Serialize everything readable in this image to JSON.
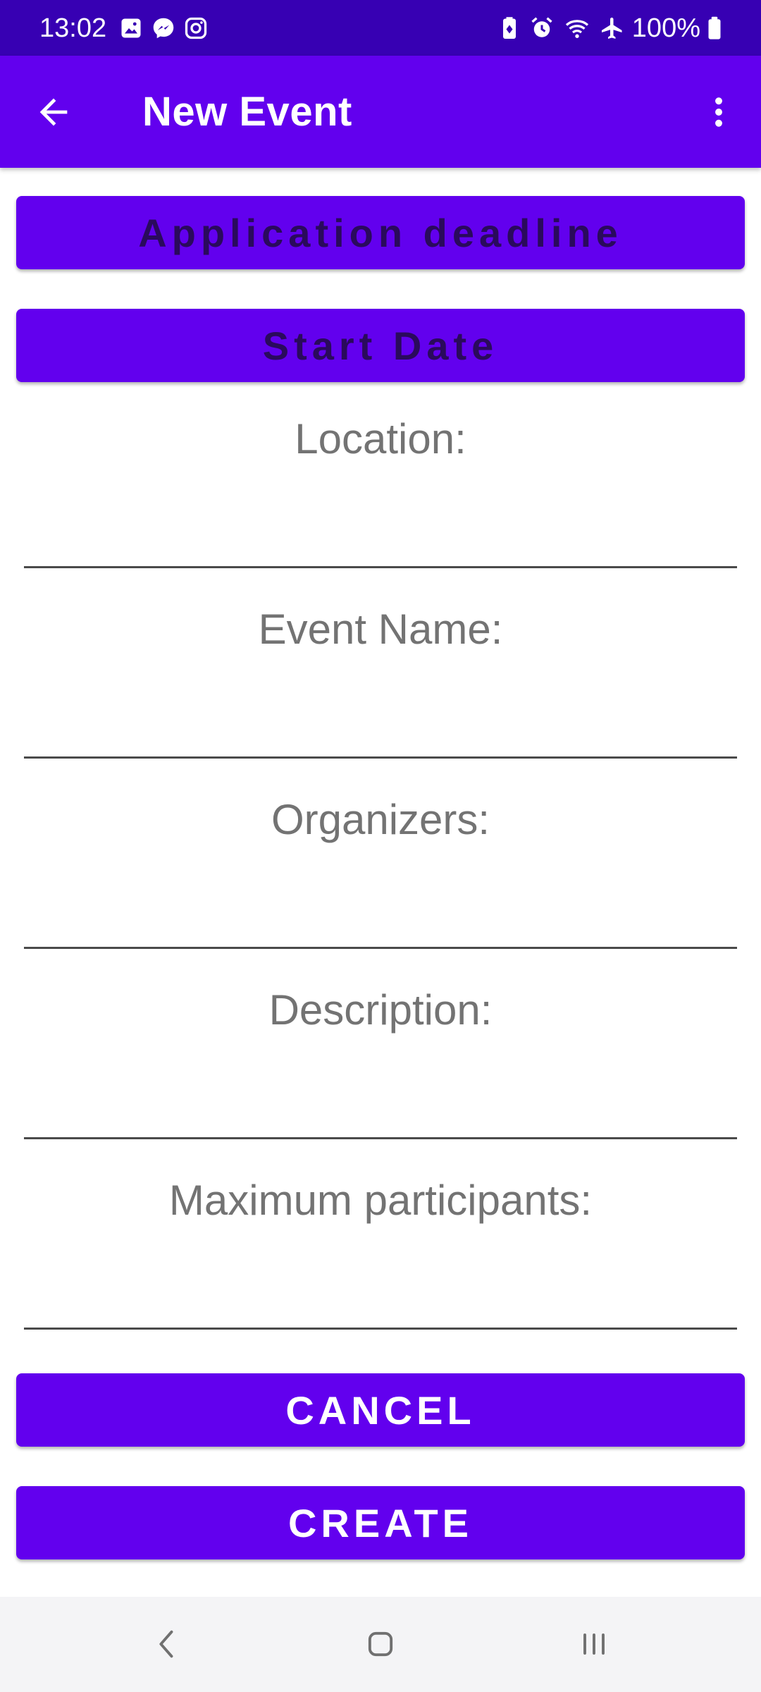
{
  "status_bar": {
    "time": "13:02",
    "left_icons": [
      "gallery-icon",
      "messenger-icon",
      "instagram-icon"
    ],
    "right_icons": [
      "battery-saver-icon",
      "alarm-icon",
      "wifi-icon",
      "airplane-icon"
    ],
    "battery_text": "100%",
    "background": "#3700b3"
  },
  "toolbar": {
    "title": "New Event",
    "back_icon": "arrow-back-icon",
    "overflow_icon": "more-vert-icon",
    "background": "#6200ee"
  },
  "form": {
    "application_deadline_label": "Application deadline",
    "start_date_label": "Start Date",
    "fields": [
      {
        "label": "Location:",
        "value": ""
      },
      {
        "label": "Event Name:",
        "value": ""
      },
      {
        "label": "Organizers:",
        "value": ""
      },
      {
        "label": "Description:",
        "value": ""
      },
      {
        "label": "Maximum participants:",
        "value": ""
      }
    ],
    "cancel_label": "CANCEL",
    "create_label": "CREATE",
    "accent": "#6200ee"
  },
  "nav_bar": {
    "buttons": [
      "back-nav-icon",
      "home-nav-icon",
      "recents-nav-icon"
    ]
  }
}
